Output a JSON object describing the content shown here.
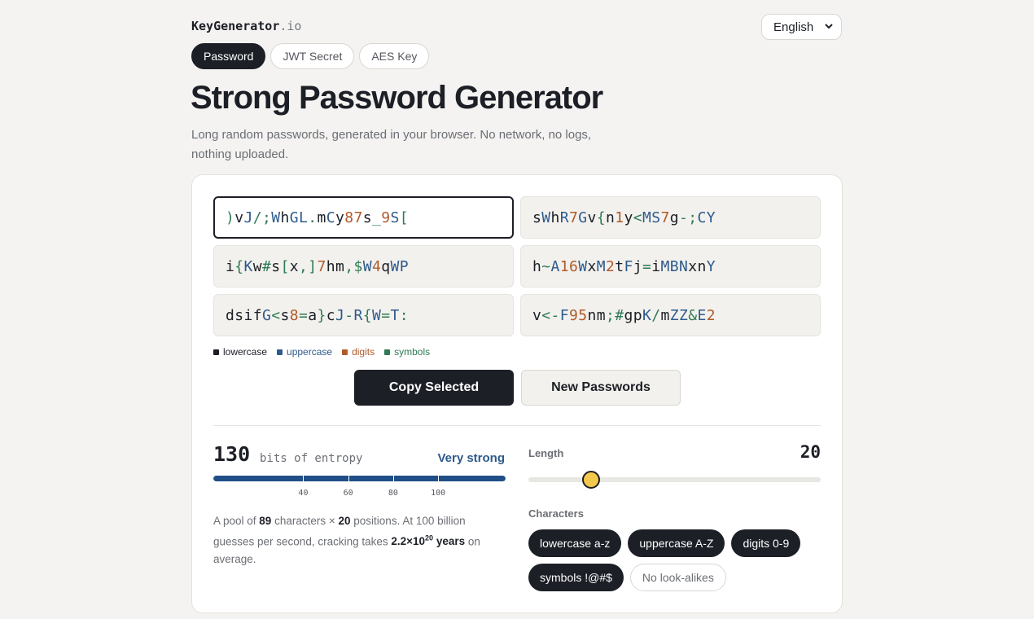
{
  "brand": {
    "name": "KeyGenerator",
    "tld": ".io"
  },
  "language": {
    "selected": "English"
  },
  "tabs": [
    {
      "label": "Password",
      "active": true
    },
    {
      "label": "JWT Secret",
      "active": false
    },
    {
      "label": "AES Key",
      "active": false
    }
  ],
  "page": {
    "title": "Strong Password Generator",
    "subtitle": "Long random passwords, generated in your browser. No network, no logs, nothing uploaded."
  },
  "passwords": [
    {
      "value": ")vJ/;WhGL.mCy87s_9S[",
      "selected": true
    },
    {
      "value": "sWhR7Gv{n1y<MS7g-;CY",
      "selected": false
    },
    {
      "value": "i{Kw#s[x,]7hm,$W4qWP",
      "selected": false
    },
    {
      "value": "h~A16WxM2tFj=iMBNxnY",
      "selected": false
    },
    {
      "value": "dsifG<s8=a}cJ-R{W=T:",
      "selected": false
    },
    {
      "value": "v<-F95nm;#gpK/mZZ&E2",
      "selected": false
    }
  ],
  "legend": [
    {
      "label": "lowercase",
      "color": "#1c1f26"
    },
    {
      "label": "uppercase",
      "color": "#2d5a8c"
    },
    {
      "label": "digits",
      "color": "#b05a2a"
    },
    {
      "label": "symbols",
      "color": "#2e7a55"
    }
  ],
  "actions": {
    "copy": "Copy Selected",
    "regenerate": "New Passwords"
  },
  "entropy": {
    "bits": "130",
    "label": "bits of entropy",
    "strength": "Very strong",
    "fraction": 1.0,
    "ticks": [
      "40",
      "60",
      "80",
      "100"
    ],
    "scale_max": 130
  },
  "explanation": {
    "prefix": "A pool of ",
    "pool": "89",
    "mid1": " characters × ",
    "positions": "20",
    "mid2": " positions. At 100 billion guesses per second, cracking takes ",
    "time_base": "2.2×10",
    "time_exp": "20",
    "time_unit": " years",
    "suffix": " on average."
  },
  "length": {
    "label": "Length",
    "value": "20",
    "min": 8,
    "max": 64
  },
  "characters": {
    "label": "Characters",
    "options": [
      {
        "label": "lowercase a-z",
        "on": true
      },
      {
        "label": "uppercase A-Z",
        "on": true
      },
      {
        "label": "digits 0-9",
        "on": true
      },
      {
        "label": "symbols !@#$",
        "on": true
      },
      {
        "label": "No look-alikes",
        "on": false
      }
    ]
  }
}
